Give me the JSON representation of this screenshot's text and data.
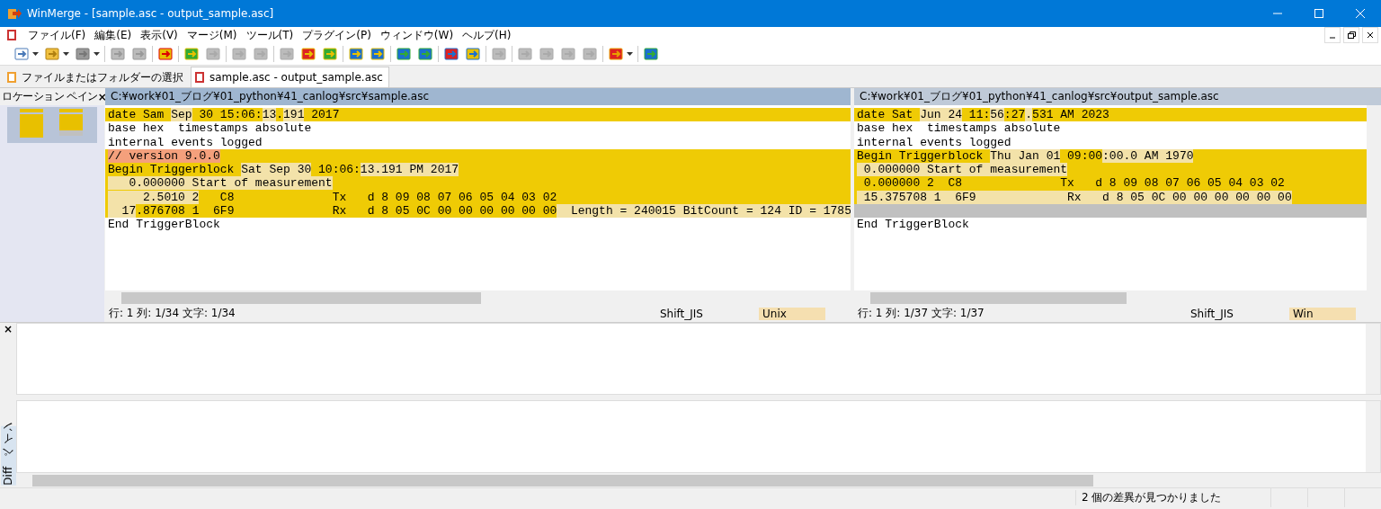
{
  "window": {
    "title": "WinMerge - [sample.asc - output_sample.asc]"
  },
  "menu": [
    "ファイル(F)",
    "編集(E)",
    "表示(V)",
    "マージ(M)",
    "ツール(T)",
    "プラグイン(P)",
    "ウィンドウ(W)",
    "ヘルプ(H)"
  ],
  "tabs": [
    {
      "label": "ファイルまたはフォルダーの選択",
      "selected": false
    },
    {
      "label": "sample.asc - output_sample.asc",
      "selected": true
    }
  ],
  "location_pane": {
    "title": "ロケーション ペイン",
    "close": "×"
  },
  "panes": [
    {
      "path": "C:¥work¥01_ブログ¥01_python¥41_canlog¥src¥sample.asc",
      "active": true,
      "lines": [
        {
          "kind": "diff",
          "parts": [
            {
              "text": "date Sam ",
              "changed": false
            },
            {
              "text": "Sep",
              "changed": true
            },
            {
              "text": " 30 15:06:",
              "changed": false
            },
            {
              "text": "13",
              "changed": true
            },
            {
              "text": ".",
              "changed": false
            },
            {
              "text": "191",
              "changed": true
            },
            {
              "text": " 2017",
              "changed": false
            }
          ]
        },
        {
          "kind": "same",
          "parts": [
            {
              "text": "base hex  timestamps absolute",
              "changed": false
            }
          ]
        },
        {
          "kind": "same",
          "parts": [
            {
              "text": "internal events logged",
              "changed": false
            }
          ]
        },
        {
          "kind": "moved",
          "parts": [
            {
              "text": "// version 9.0.0",
              "changed": true
            }
          ]
        },
        {
          "kind": "diff",
          "parts": [
            {
              "text": "Begin Triggerblock ",
              "changed": false
            },
            {
              "text": "Sat Sep 30",
              "changed": true
            },
            {
              "text": " 10:06:",
              "changed": false
            },
            {
              "text": "13.191 PM 2017",
              "changed": true
            }
          ]
        },
        {
          "kind": "diff",
          "parts": [
            {
              "text": "   0.000000 Start of measurement",
              "changed": true
            }
          ]
        },
        {
          "kind": "diff",
          "parts": [
            {
              "text": "     2.5010 2",
              "changed": true
            },
            {
              "text": "   C8              Tx   d 8 09 08 07 06 05 04 03 02",
              "changed": false
            }
          ]
        },
        {
          "kind": "diff",
          "parts": [
            {
              "text": "  17",
              "changed": true
            },
            {
              "text": ".876708 1  6F9              Rx   d 8 05 0C 00 00 00 00 00 00",
              "changed": false
            },
            {
              "text": "  Length = 240015 BitCount = 124 ID = 1785",
              "changed": true
            }
          ]
        },
        {
          "kind": "same",
          "parts": [
            {
              "text": "End TriggerBlock",
              "changed": false
            }
          ]
        }
      ],
      "status": {
        "position": "行: 1  列: 1/34  文字: 1/34",
        "encoding": "Shift_JIS",
        "eol": "Unix"
      }
    },
    {
      "path": "C:¥work¥01_ブログ¥01_python¥41_canlog¥src¥output_sample.asc",
      "active": false,
      "lines": [
        {
          "kind": "diff",
          "parts": [
            {
              "text": "date Sat ",
              "changed": false
            },
            {
              "text": "Jun 24",
              "changed": true
            },
            {
              "text": " 11:",
              "changed": false
            },
            {
              "text": "56",
              "changed": true
            },
            {
              "text": ":27",
              "changed": false
            },
            {
              "text": ".",
              "changed": true
            },
            {
              "text": "531 AM 2023",
              "changed": false
            }
          ]
        },
        {
          "kind": "same",
          "parts": [
            {
              "text": "base hex  timestamps absolute",
              "changed": false
            }
          ]
        },
        {
          "kind": "same",
          "parts": [
            {
              "text": "internal events logged",
              "changed": false
            }
          ]
        },
        {
          "kind": "diff",
          "parts": [
            {
              "text": "Begin Triggerblock ",
              "changed": false
            },
            {
              "text": "Thu Jan 01",
              "changed": true
            },
            {
              "text": " 09:00",
              "changed": false
            },
            {
              "text": ":00.0 AM 1970",
              "changed": true
            }
          ]
        },
        {
          "kind": "diff",
          "parts": [
            {
              "text": " 0.000000 Start of measurement",
              "changed": true
            }
          ]
        },
        {
          "kind": "diff",
          "parts": [
            {
              "text": " 0.000000 2  C8              Tx   d 8 09 08 07 06 05 04 03 02",
              "changed": false
            }
          ]
        },
        {
          "kind": "diff",
          "parts": [
            {
              "text": " 15.375708 1  6F9             Rx   d 8 05 0C 00 00 00 00 00 00",
              "changed": true
            }
          ]
        },
        {
          "kind": "blank"
        },
        {
          "kind": "same",
          "parts": [
            {
              "text": "End TriggerBlock",
              "changed": false
            }
          ]
        }
      ],
      "status": {
        "position": "行: 1  列: 1/37  文字: 1/37",
        "encoding": "Shift_JIS",
        "eol": "Win"
      }
    }
  ],
  "diff_pane": {
    "close": "×",
    "title": "Diff ペイン"
  },
  "status_bar": "2 個の差異が見つかりました"
}
